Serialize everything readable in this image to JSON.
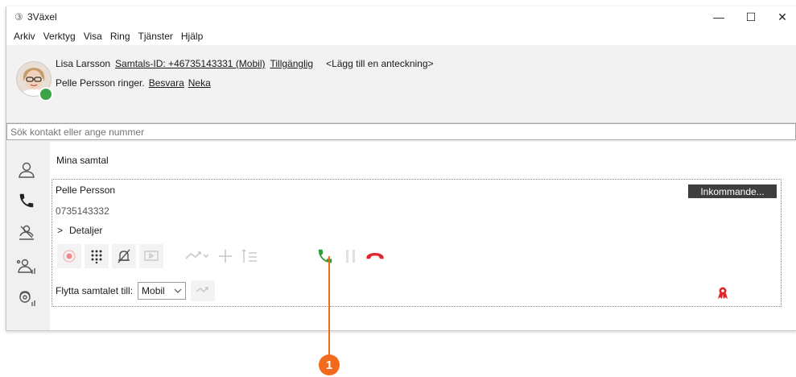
{
  "window": {
    "title": "3Växel",
    "logo_glyph": "③",
    "controls": {
      "minimize": "—",
      "maximize": "☐",
      "close": "✕"
    }
  },
  "menu": [
    "Arkiv",
    "Verktyg",
    "Visa",
    "Ring",
    "Tjänster",
    "Hjälp"
  ],
  "header": {
    "user_name": "Lisa Larsson",
    "caller_id_link": "Samtals-ID: +46735143331 (Mobil)",
    "availability_link": "Tillgänglig",
    "note_link": "<Lägg till en anteckning>",
    "incoming_text": "Pelle Persson ringer.",
    "answer_link": "Besvara",
    "decline_link": "Neka",
    "status_color": "#3aa447"
  },
  "search": {
    "placeholder": "Sök kontakt eller ange nummer"
  },
  "sidebar": {
    "icons": [
      "contacts-icon",
      "phone-icon",
      "switchboard-icon",
      "groups-icon",
      "queue-icon"
    ]
  },
  "main": {
    "section_title": "Mina samtal",
    "call": {
      "caller_name": "Pelle Persson",
      "caller_number": "0735143332",
      "details_label": "Detaljer",
      "details_chevron": ">",
      "incoming_badge": "Inkommande...",
      "transfer_label": "Flytta samtalet till:",
      "transfer_selected": "Mobil"
    }
  },
  "callout": {
    "number": "1",
    "color": "#f26a1b"
  },
  "colors": {
    "answer_green": "#2e9e3c",
    "hangup_red": "#e0262a",
    "disabled_grey": "#c8c8c8"
  }
}
